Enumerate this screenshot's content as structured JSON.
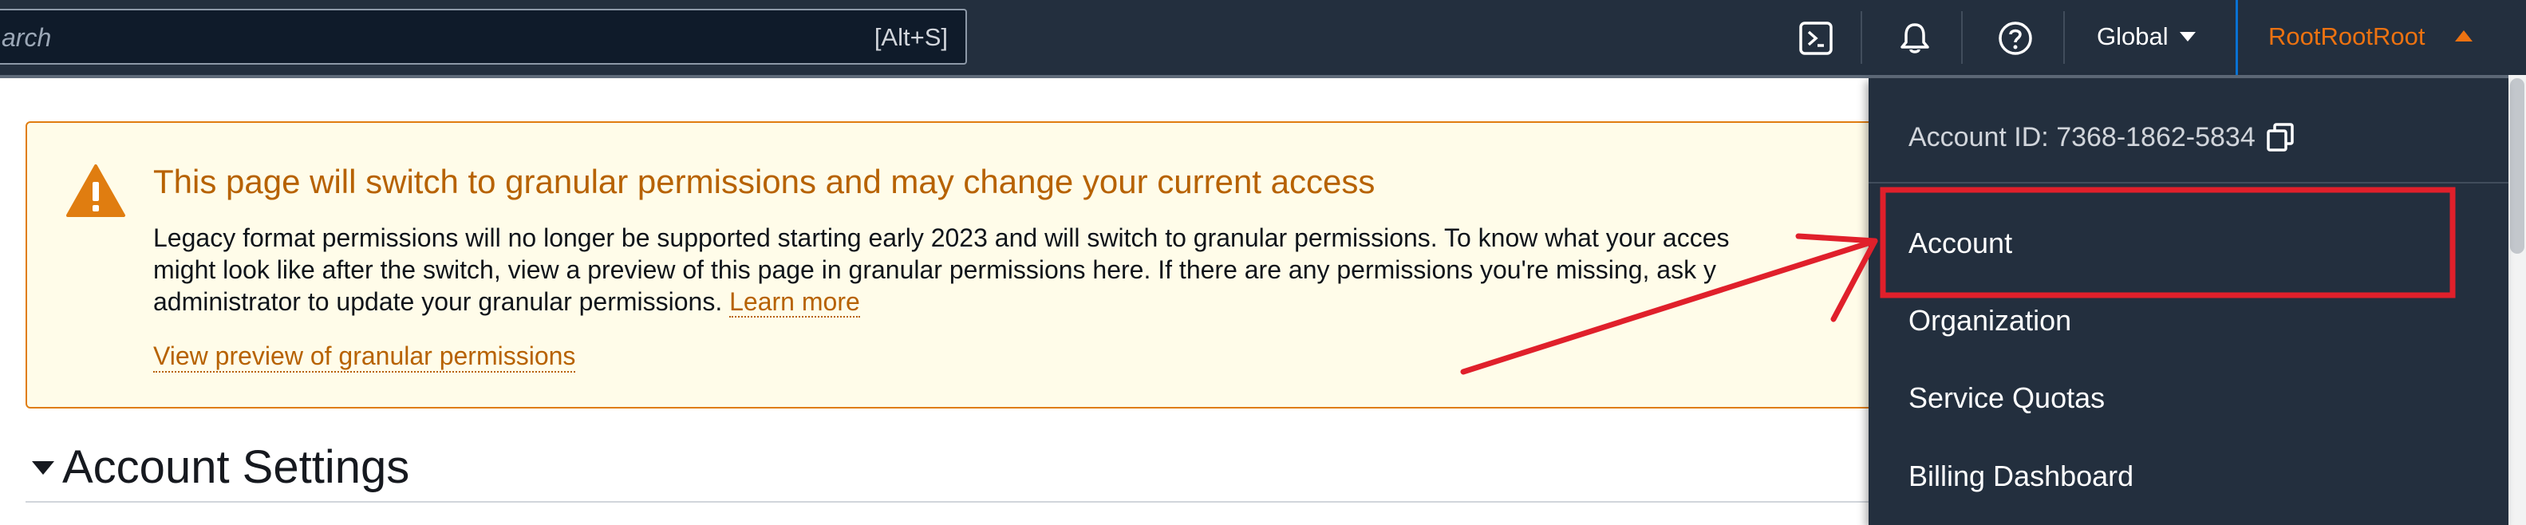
{
  "topbar": {
    "search": {
      "text": "arch",
      "shortcut": "[Alt+S]"
    },
    "icons": [
      "cloudshell-icon",
      "bell-icon",
      "help-icon"
    ],
    "region": "Global",
    "account_name": "RootRootRoot"
  },
  "alert": {
    "title": "This page will switch to granular permissions and may change your current access",
    "body_lines": [
      "Legacy format permissions will no longer be supported starting early 2023 and will switch to granular permissions. To know what your acces",
      "might look like after the switch, view a preview of this page in granular permissions here. If there are any permissions you're missing, ask y",
      "administrator to update your granular permissions."
    ],
    "learn_more": "Learn more",
    "preview_link": "View preview of granular permissions"
  },
  "section": {
    "title": "Account Settings"
  },
  "account_menu": {
    "account_id": "Account ID: 7368-1862-5834",
    "items": [
      {
        "label": "Account",
        "highlighted": true
      },
      {
        "label": "Organization"
      },
      {
        "label": "Service Quotas"
      },
      {
        "label": "Billing Dashboard"
      }
    ]
  },
  "colors": {
    "nav_bg": "#232f3e",
    "accent_orange": "#ec7211",
    "alert_bg": "#fffce9",
    "alert_border": "#e07d10",
    "annotation_red": "#e0202b"
  }
}
